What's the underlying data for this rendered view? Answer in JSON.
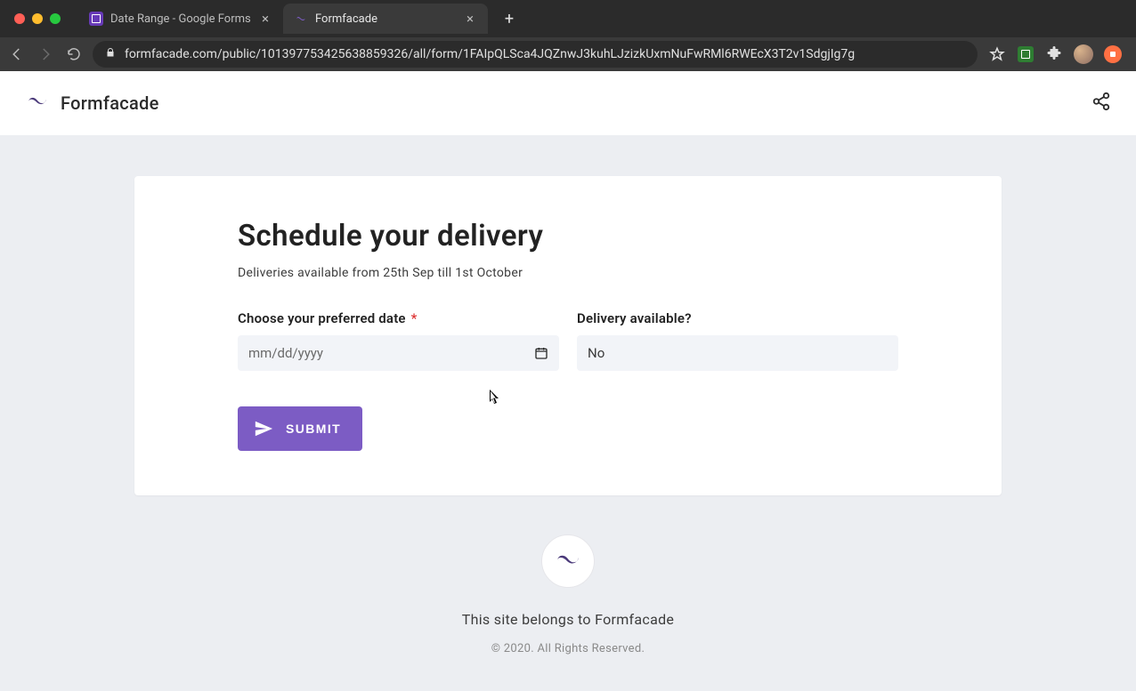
{
  "browser": {
    "tabs": [
      {
        "title": "Date Range - Google Forms",
        "active": false
      },
      {
        "title": "Formfacade",
        "active": true
      }
    ],
    "url": "formfacade.com/public/101397753425638859326/all/form/1FAIpQLSca4JQZnwJ3kuhLJzizkUxmNuFwRMl6RWEcX3T2v1SdgjIg7g"
  },
  "brand": {
    "name": "Formfacade"
  },
  "form": {
    "title": "Schedule your delivery",
    "subtitle": "Deliveries available from 25th Sep till 1st October",
    "fields": {
      "date": {
        "label": "Choose your preferred date",
        "required": true,
        "placeholder": "mm/dd/yyyy"
      },
      "availability": {
        "label": "Delivery available?",
        "value": "No"
      }
    },
    "submit_label": "SUBMIT"
  },
  "footer": {
    "belongs": "This site belongs to Formfacade",
    "copyright": "© 2020. All Rights Reserved."
  }
}
